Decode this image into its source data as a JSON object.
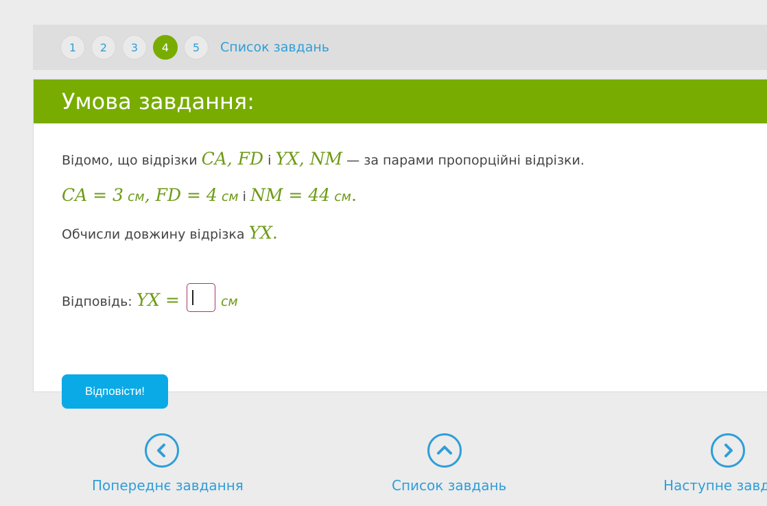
{
  "tabs": {
    "pages": [
      "1",
      "2",
      "3",
      "4",
      "5"
    ],
    "active": "4",
    "task_list_label": "Список завдань"
  },
  "card": {
    "header": "Умова завдання:",
    "line1": {
      "text_before": "Відомо, що відрізки",
      "segments1": "CA, FD",
      "conj": "і",
      "segments2": "YX, NM",
      "text_after": "— за парами пропорційні відрізки."
    },
    "line2": {
      "ca": "CA = 3",
      "unit": "см",
      "fd": ", FD = 4",
      "conj": "і",
      "nm": "NM = 44",
      "end": "."
    },
    "line3": {
      "text": "Обчисли довжину відрізка",
      "segment": "YX."
    },
    "answer": {
      "label": "Відповідь:",
      "expr": "YX =",
      "value": "",
      "unit": "см"
    },
    "submit_label": "Відповісти!"
  },
  "nav": {
    "prev_label": "Попереднє завдання",
    "list_label": "Список завдань",
    "next_label": "Наступне завдання"
  },
  "colors": {
    "accent_green": "#78ac00",
    "link_blue": "#2f9ed8",
    "button_blue": "#0aaae6",
    "input_border": "#a9336d"
  }
}
